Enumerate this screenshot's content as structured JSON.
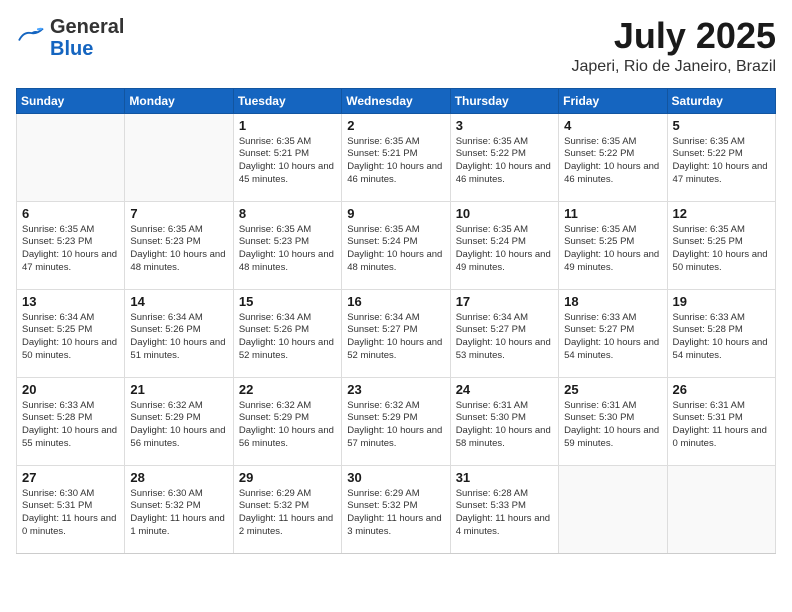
{
  "header": {
    "logo_general": "General",
    "logo_blue": "Blue",
    "month": "July 2025",
    "location": "Japeri, Rio de Janeiro, Brazil"
  },
  "weekdays": [
    "Sunday",
    "Monday",
    "Tuesday",
    "Wednesday",
    "Thursday",
    "Friday",
    "Saturday"
  ],
  "weeks": [
    [
      {
        "day": "",
        "text": ""
      },
      {
        "day": "",
        "text": ""
      },
      {
        "day": "1",
        "text": "Sunrise: 6:35 AM\nSunset: 5:21 PM\nDaylight: 10 hours and 45 minutes."
      },
      {
        "day": "2",
        "text": "Sunrise: 6:35 AM\nSunset: 5:21 PM\nDaylight: 10 hours and 46 minutes."
      },
      {
        "day": "3",
        "text": "Sunrise: 6:35 AM\nSunset: 5:22 PM\nDaylight: 10 hours and 46 minutes."
      },
      {
        "day": "4",
        "text": "Sunrise: 6:35 AM\nSunset: 5:22 PM\nDaylight: 10 hours and 46 minutes."
      },
      {
        "day": "5",
        "text": "Sunrise: 6:35 AM\nSunset: 5:22 PM\nDaylight: 10 hours and 47 minutes."
      }
    ],
    [
      {
        "day": "6",
        "text": "Sunrise: 6:35 AM\nSunset: 5:23 PM\nDaylight: 10 hours and 47 minutes."
      },
      {
        "day": "7",
        "text": "Sunrise: 6:35 AM\nSunset: 5:23 PM\nDaylight: 10 hours and 48 minutes."
      },
      {
        "day": "8",
        "text": "Sunrise: 6:35 AM\nSunset: 5:23 PM\nDaylight: 10 hours and 48 minutes."
      },
      {
        "day": "9",
        "text": "Sunrise: 6:35 AM\nSunset: 5:24 PM\nDaylight: 10 hours and 48 minutes."
      },
      {
        "day": "10",
        "text": "Sunrise: 6:35 AM\nSunset: 5:24 PM\nDaylight: 10 hours and 49 minutes."
      },
      {
        "day": "11",
        "text": "Sunrise: 6:35 AM\nSunset: 5:25 PM\nDaylight: 10 hours and 49 minutes."
      },
      {
        "day": "12",
        "text": "Sunrise: 6:35 AM\nSunset: 5:25 PM\nDaylight: 10 hours and 50 minutes."
      }
    ],
    [
      {
        "day": "13",
        "text": "Sunrise: 6:34 AM\nSunset: 5:25 PM\nDaylight: 10 hours and 50 minutes."
      },
      {
        "day": "14",
        "text": "Sunrise: 6:34 AM\nSunset: 5:26 PM\nDaylight: 10 hours and 51 minutes."
      },
      {
        "day": "15",
        "text": "Sunrise: 6:34 AM\nSunset: 5:26 PM\nDaylight: 10 hours and 52 minutes."
      },
      {
        "day": "16",
        "text": "Sunrise: 6:34 AM\nSunset: 5:27 PM\nDaylight: 10 hours and 52 minutes."
      },
      {
        "day": "17",
        "text": "Sunrise: 6:34 AM\nSunset: 5:27 PM\nDaylight: 10 hours and 53 minutes."
      },
      {
        "day": "18",
        "text": "Sunrise: 6:33 AM\nSunset: 5:27 PM\nDaylight: 10 hours and 54 minutes."
      },
      {
        "day": "19",
        "text": "Sunrise: 6:33 AM\nSunset: 5:28 PM\nDaylight: 10 hours and 54 minutes."
      }
    ],
    [
      {
        "day": "20",
        "text": "Sunrise: 6:33 AM\nSunset: 5:28 PM\nDaylight: 10 hours and 55 minutes."
      },
      {
        "day": "21",
        "text": "Sunrise: 6:32 AM\nSunset: 5:29 PM\nDaylight: 10 hours and 56 minutes."
      },
      {
        "day": "22",
        "text": "Sunrise: 6:32 AM\nSunset: 5:29 PM\nDaylight: 10 hours and 56 minutes."
      },
      {
        "day": "23",
        "text": "Sunrise: 6:32 AM\nSunset: 5:29 PM\nDaylight: 10 hours and 57 minutes."
      },
      {
        "day": "24",
        "text": "Sunrise: 6:31 AM\nSunset: 5:30 PM\nDaylight: 10 hours and 58 minutes."
      },
      {
        "day": "25",
        "text": "Sunrise: 6:31 AM\nSunset: 5:30 PM\nDaylight: 10 hours and 59 minutes."
      },
      {
        "day": "26",
        "text": "Sunrise: 6:31 AM\nSunset: 5:31 PM\nDaylight: 11 hours and 0 minutes."
      }
    ],
    [
      {
        "day": "27",
        "text": "Sunrise: 6:30 AM\nSunset: 5:31 PM\nDaylight: 11 hours and 0 minutes."
      },
      {
        "day": "28",
        "text": "Sunrise: 6:30 AM\nSunset: 5:32 PM\nDaylight: 11 hours and 1 minute."
      },
      {
        "day": "29",
        "text": "Sunrise: 6:29 AM\nSunset: 5:32 PM\nDaylight: 11 hours and 2 minutes."
      },
      {
        "day": "30",
        "text": "Sunrise: 6:29 AM\nSunset: 5:32 PM\nDaylight: 11 hours and 3 minutes."
      },
      {
        "day": "31",
        "text": "Sunrise: 6:28 AM\nSunset: 5:33 PM\nDaylight: 11 hours and 4 minutes."
      },
      {
        "day": "",
        "text": ""
      },
      {
        "day": "",
        "text": ""
      }
    ]
  ]
}
